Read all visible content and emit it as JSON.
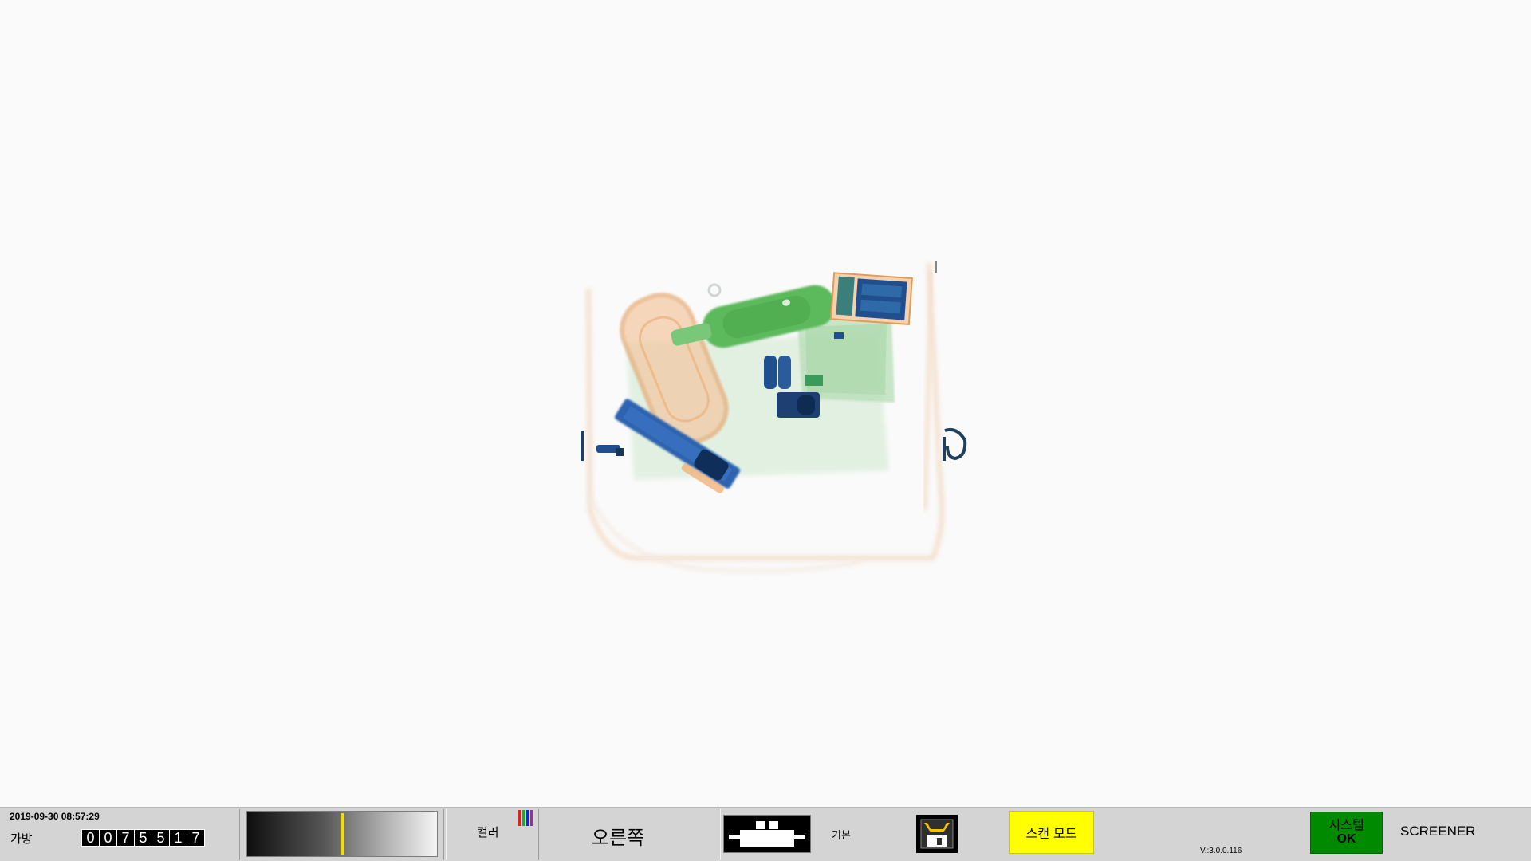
{
  "status_bar": {
    "datetime": "2019-09-30 08:57:29",
    "bag_label": "가방",
    "bag_counter_digits": [
      "0",
      "0",
      "7",
      "5",
      "5",
      "1",
      "7"
    ],
    "grayscale_marker_fraction": 0.5,
    "color_label": "컬러",
    "color_icon": "color-stripes-icon",
    "direction_label": "오른쪽",
    "belt_icon": "conveyor-belt-icon",
    "mode_label": "기본",
    "save_icon": "save-floppy-icon",
    "scan_mode_label": "스캔 모드",
    "version": "V.:3.0.0.116",
    "system_label": "시스템",
    "system_status": "OK",
    "user_role": "SCREENER"
  },
  "colors": {
    "organic": "#e39a55",
    "inorganic": "#3fae4a",
    "metal": "#1f4f8f",
    "scan_mode_bg": "#ffff00",
    "system_ok_bg": "#008a00",
    "gray_marker": "#f2df00"
  }
}
